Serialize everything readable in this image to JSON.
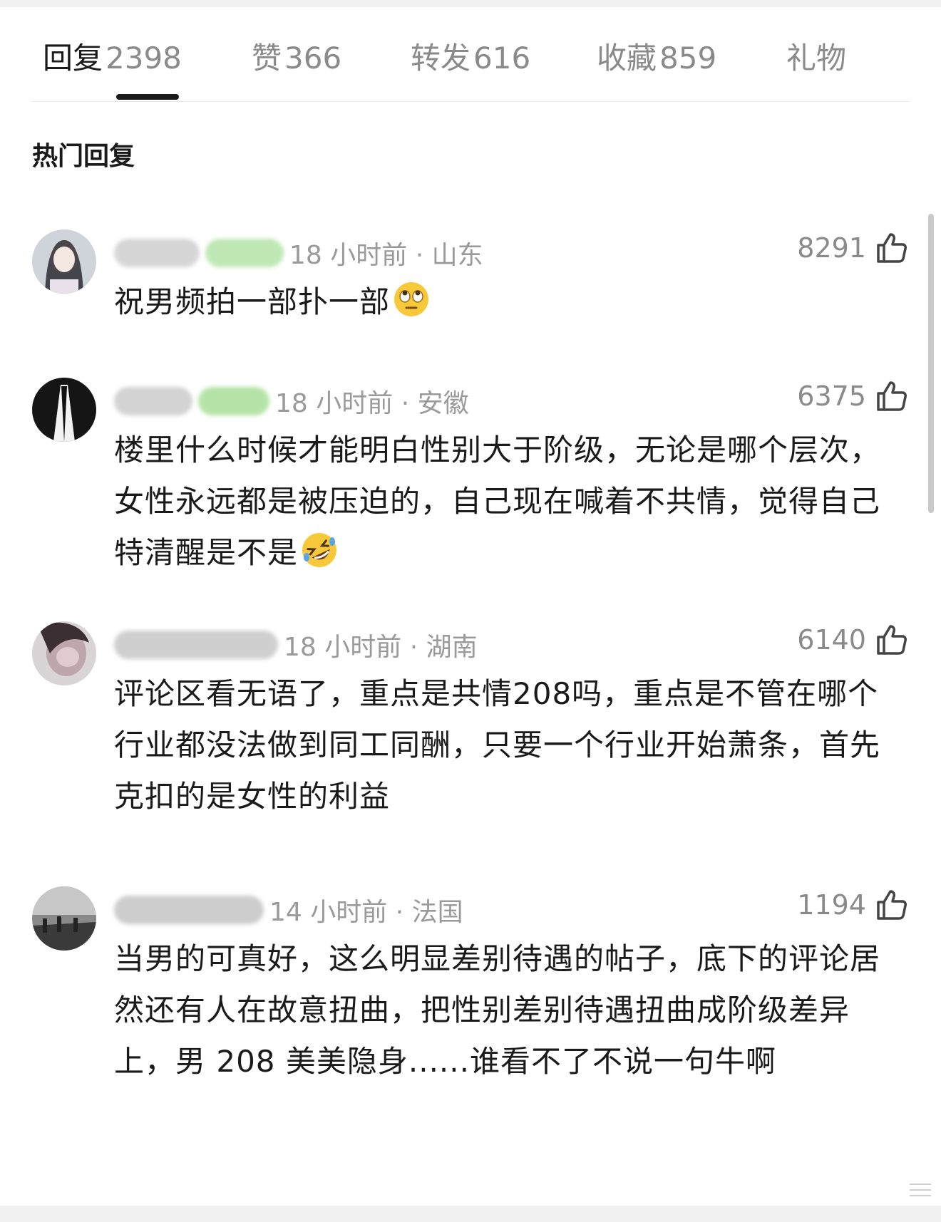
{
  "tabs": [
    {
      "label": "回复",
      "count": "2398"
    },
    {
      "label": "赞",
      "count": "366"
    },
    {
      "label": "转发",
      "count": "616"
    },
    {
      "label": "收藏",
      "count": "859"
    },
    {
      "label": "礼物",
      "count": ""
    }
  ],
  "section_title": "热门回复",
  "comments": [
    {
      "meta": "18 小时前 · 山东",
      "likes": "8291",
      "text": "祝男频拍一部扑一部",
      "emoji_icon": "eye-roll-emoji-icon"
    },
    {
      "meta": "18 小时前 · 安徽",
      "likes": "6375",
      "text": "楼里什么时候才能明白性别大于阶级，无论是哪个层次，女性永远都是被压迫的，自己现在喊着不共情，觉得自己特清醒是不是",
      "emoji_icon": "rolling-laughing-emoji-icon"
    },
    {
      "meta": "18 小时前 · 湖南",
      "likes": "6140",
      "text": "评论区看无语了，重点是共情208吗，重点是不管在哪个行业都没法做到同工同酬，只要一个行业开始萧条，首先克扣的是女性的利益"
    },
    {
      "meta": "14 小时前 · 法国",
      "likes": "1194",
      "text": "当男的可真好，这么明显差别待遇的帖子，底下的评论居然还有人在故意扭曲，把性别差别待遇扭曲成阶级差异上，男 208 美美隐身......谁看不了不说一句牛啊"
    }
  ],
  "colors": {
    "text_primary": "#1a1a1a",
    "text_secondary": "#8a8a8a",
    "indicator": "#1a1a1a",
    "page_bg": "#f1f1f1"
  }
}
